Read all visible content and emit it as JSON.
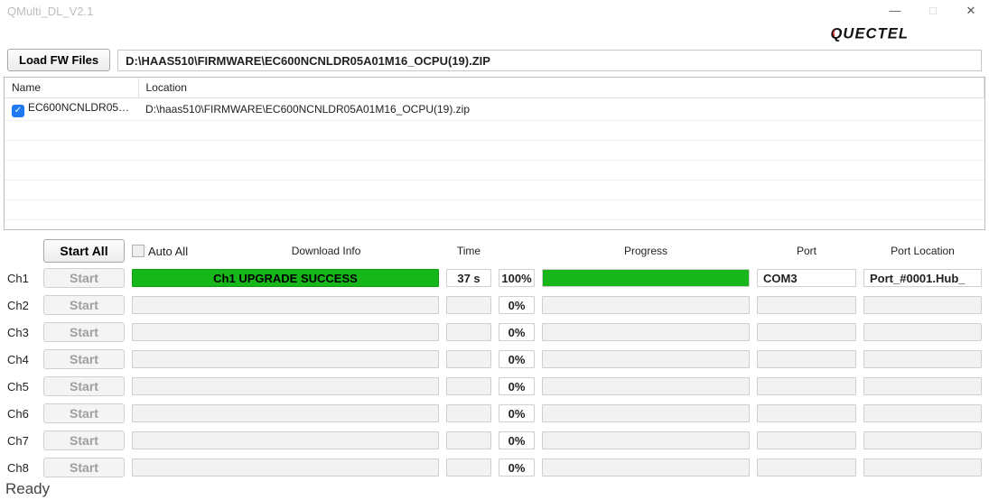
{
  "window": {
    "title": "QMulti_DL_V2.1"
  },
  "brand": "QUECTEL",
  "load_fw": {
    "button": "Load FW Files",
    "path": "D:\\HAAS510\\FIRMWARE\\EC600NCNLDR05A01M16_OCPU(19).ZIP"
  },
  "file_table": {
    "headers": {
      "name": "Name",
      "location": "Location"
    },
    "rows": [
      {
        "checked": true,
        "name": "EC600NCNLDR05A0...",
        "location": "D:\\haas510\\FIRMWARE\\EC600NCNLDR05A01M16_OCPU(19).zip"
      }
    ]
  },
  "controls": {
    "start_all": "Start All",
    "auto_all": "Auto All",
    "download_info": "Download Info",
    "time": "Time",
    "progress": "Progress",
    "port": "Port",
    "port_location": "Port Location",
    "start": "Start"
  },
  "channels": [
    {
      "id": "Ch1",
      "info": "Ch1 UPGRADE SUCCESS",
      "time": "37 s",
      "pct": "100%",
      "progress": 100,
      "port": "COM3",
      "port_loc": "Port_#0001.Hub_",
      "success": true,
      "enabled": false
    },
    {
      "id": "Ch2",
      "info": "",
      "time": "",
      "pct": "0%",
      "progress": 0,
      "port": "",
      "port_loc": "",
      "success": false,
      "enabled": false
    },
    {
      "id": "Ch3",
      "info": "",
      "time": "",
      "pct": "0%",
      "progress": 0,
      "port": "",
      "port_loc": "",
      "success": false,
      "enabled": false
    },
    {
      "id": "Ch4",
      "info": "",
      "time": "",
      "pct": "0%",
      "progress": 0,
      "port": "",
      "port_loc": "",
      "success": false,
      "enabled": false
    },
    {
      "id": "Ch5",
      "info": "",
      "time": "",
      "pct": "0%",
      "progress": 0,
      "port": "",
      "port_loc": "",
      "success": false,
      "enabled": false
    },
    {
      "id": "Ch6",
      "info": "",
      "time": "",
      "pct": "0%",
      "progress": 0,
      "port": "",
      "port_loc": "",
      "success": false,
      "enabled": false
    },
    {
      "id": "Ch7",
      "info": "",
      "time": "",
      "pct": "0%",
      "progress": 0,
      "port": "",
      "port_loc": "",
      "success": false,
      "enabled": false
    },
    {
      "id": "Ch8",
      "info": "",
      "time": "",
      "pct": "0%",
      "progress": 0,
      "port": "",
      "port_loc": "",
      "success": false,
      "enabled": false
    }
  ],
  "status": "Ready"
}
